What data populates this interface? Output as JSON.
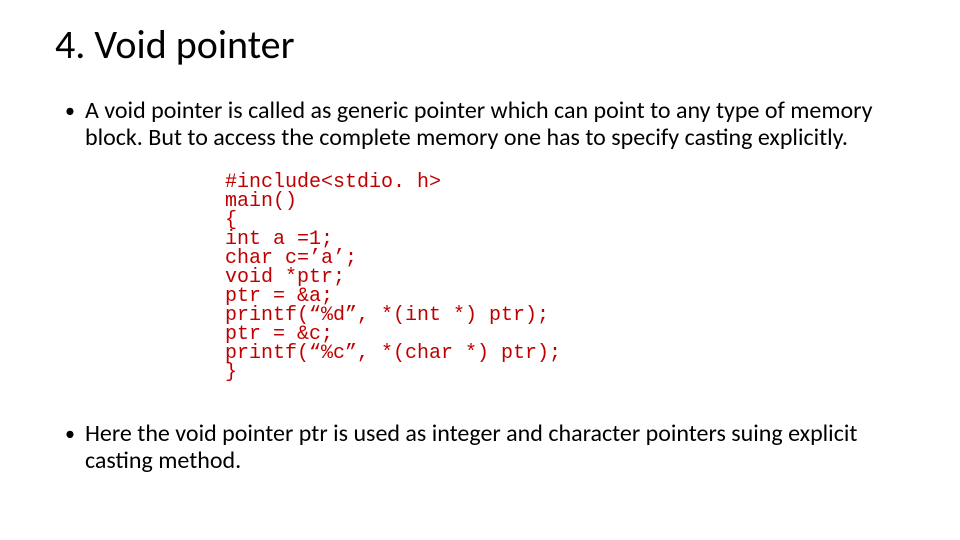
{
  "title": "4. Void pointer",
  "bullets": {
    "first": "A void pointer is called as generic pointer which can point to any type of memory block. But to access the complete memory one has to specify casting explicitly.",
    "second": "Here the void pointer ptr is used as integer and character pointers suing explicit casting method."
  },
  "code": {
    "l1": "#include<stdio. h>",
    "l2": "main()",
    "l3": "{",
    "l4": "int a =1;",
    "l5": "char c=’a’;",
    "l6": "void *ptr;",
    "l7": "ptr = &a;",
    "l8": "printf(“%d”, *(int *) ptr);",
    "l9": "ptr = &c;",
    "l10": "printf(“%c”, *(char *) ptr);",
    "l11": "}"
  }
}
